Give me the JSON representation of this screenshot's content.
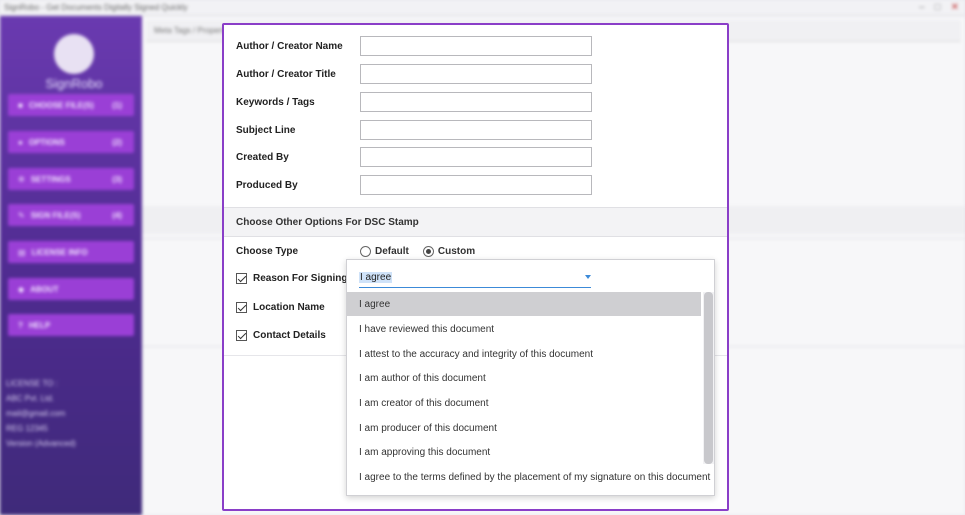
{
  "window": {
    "title": "SignRobo - Get Documents Digitally Signed Quickly",
    "controls": [
      "minimize-icon",
      "maximize-icon",
      "close-icon"
    ]
  },
  "sidebar": {
    "logo_text": "SignRobo",
    "items": [
      {
        "label": "CHOOSE FILE(S)",
        "num": "(1)",
        "icon": "file-icon"
      },
      {
        "label": "OPTIONS",
        "num": "(2)",
        "icon": "options-icon"
      },
      {
        "label": "SETTINGS",
        "num": "(3)",
        "icon": "settings-icon"
      },
      {
        "label": "SIGN FILE(S)",
        "num": "(4)",
        "icon": "sign-icon"
      },
      {
        "label": "LICENSE INFO",
        "num": "",
        "icon": "license-icon"
      },
      {
        "label": "ABOUT",
        "num": "",
        "icon": "about-icon"
      },
      {
        "label": "HELP",
        "num": "",
        "icon": "help-icon"
      }
    ],
    "license": {
      "heading": "LICENSE TO :",
      "lines": [
        "ABC Pvt. Ltd.",
        "mail@gmail.com",
        "REG 12345",
        "Version (Advanced)"
      ]
    }
  },
  "background": {
    "tab_label": "Meta Tags / Properties"
  },
  "form": {
    "fields": [
      {
        "label": "Author / Creator Name",
        "value": ""
      },
      {
        "label": "Author / Creator Title",
        "value": ""
      },
      {
        "label": "Keywords / Tags",
        "value": ""
      },
      {
        "label": "Subject Line",
        "value": ""
      },
      {
        "label": "Created By",
        "value": ""
      },
      {
        "label": "Produced By",
        "value": ""
      }
    ],
    "section_title": "Choose Other Options For DSC Stamp",
    "choose_type": {
      "label": "Choose Type",
      "options": [
        "Default",
        "Custom"
      ],
      "selected": "Custom"
    },
    "checks": [
      {
        "label": "Reason For Signing",
        "checked": true
      },
      {
        "label": "Location Name",
        "checked": true
      },
      {
        "label": "Contact Details",
        "checked": true
      }
    ]
  },
  "dropdown": {
    "value": "I agree",
    "options": [
      "I agree",
      "I have reviewed this document",
      "I attest to the accuracy and integrity of this document",
      "I am author of this document",
      "I am creator of this document",
      "I am producer of this document",
      "I am approving this document",
      "I agree to the terms defined by the placement of my signature on this document"
    ],
    "selected_index": 0
  },
  "colors": {
    "accent_purple": "#8a3ec8",
    "sidebar_top": "#6a3ab0",
    "nav_button": "#9a3fd6",
    "focus_blue": "#3c8ad8",
    "selected_option": "#cfcfd2"
  }
}
